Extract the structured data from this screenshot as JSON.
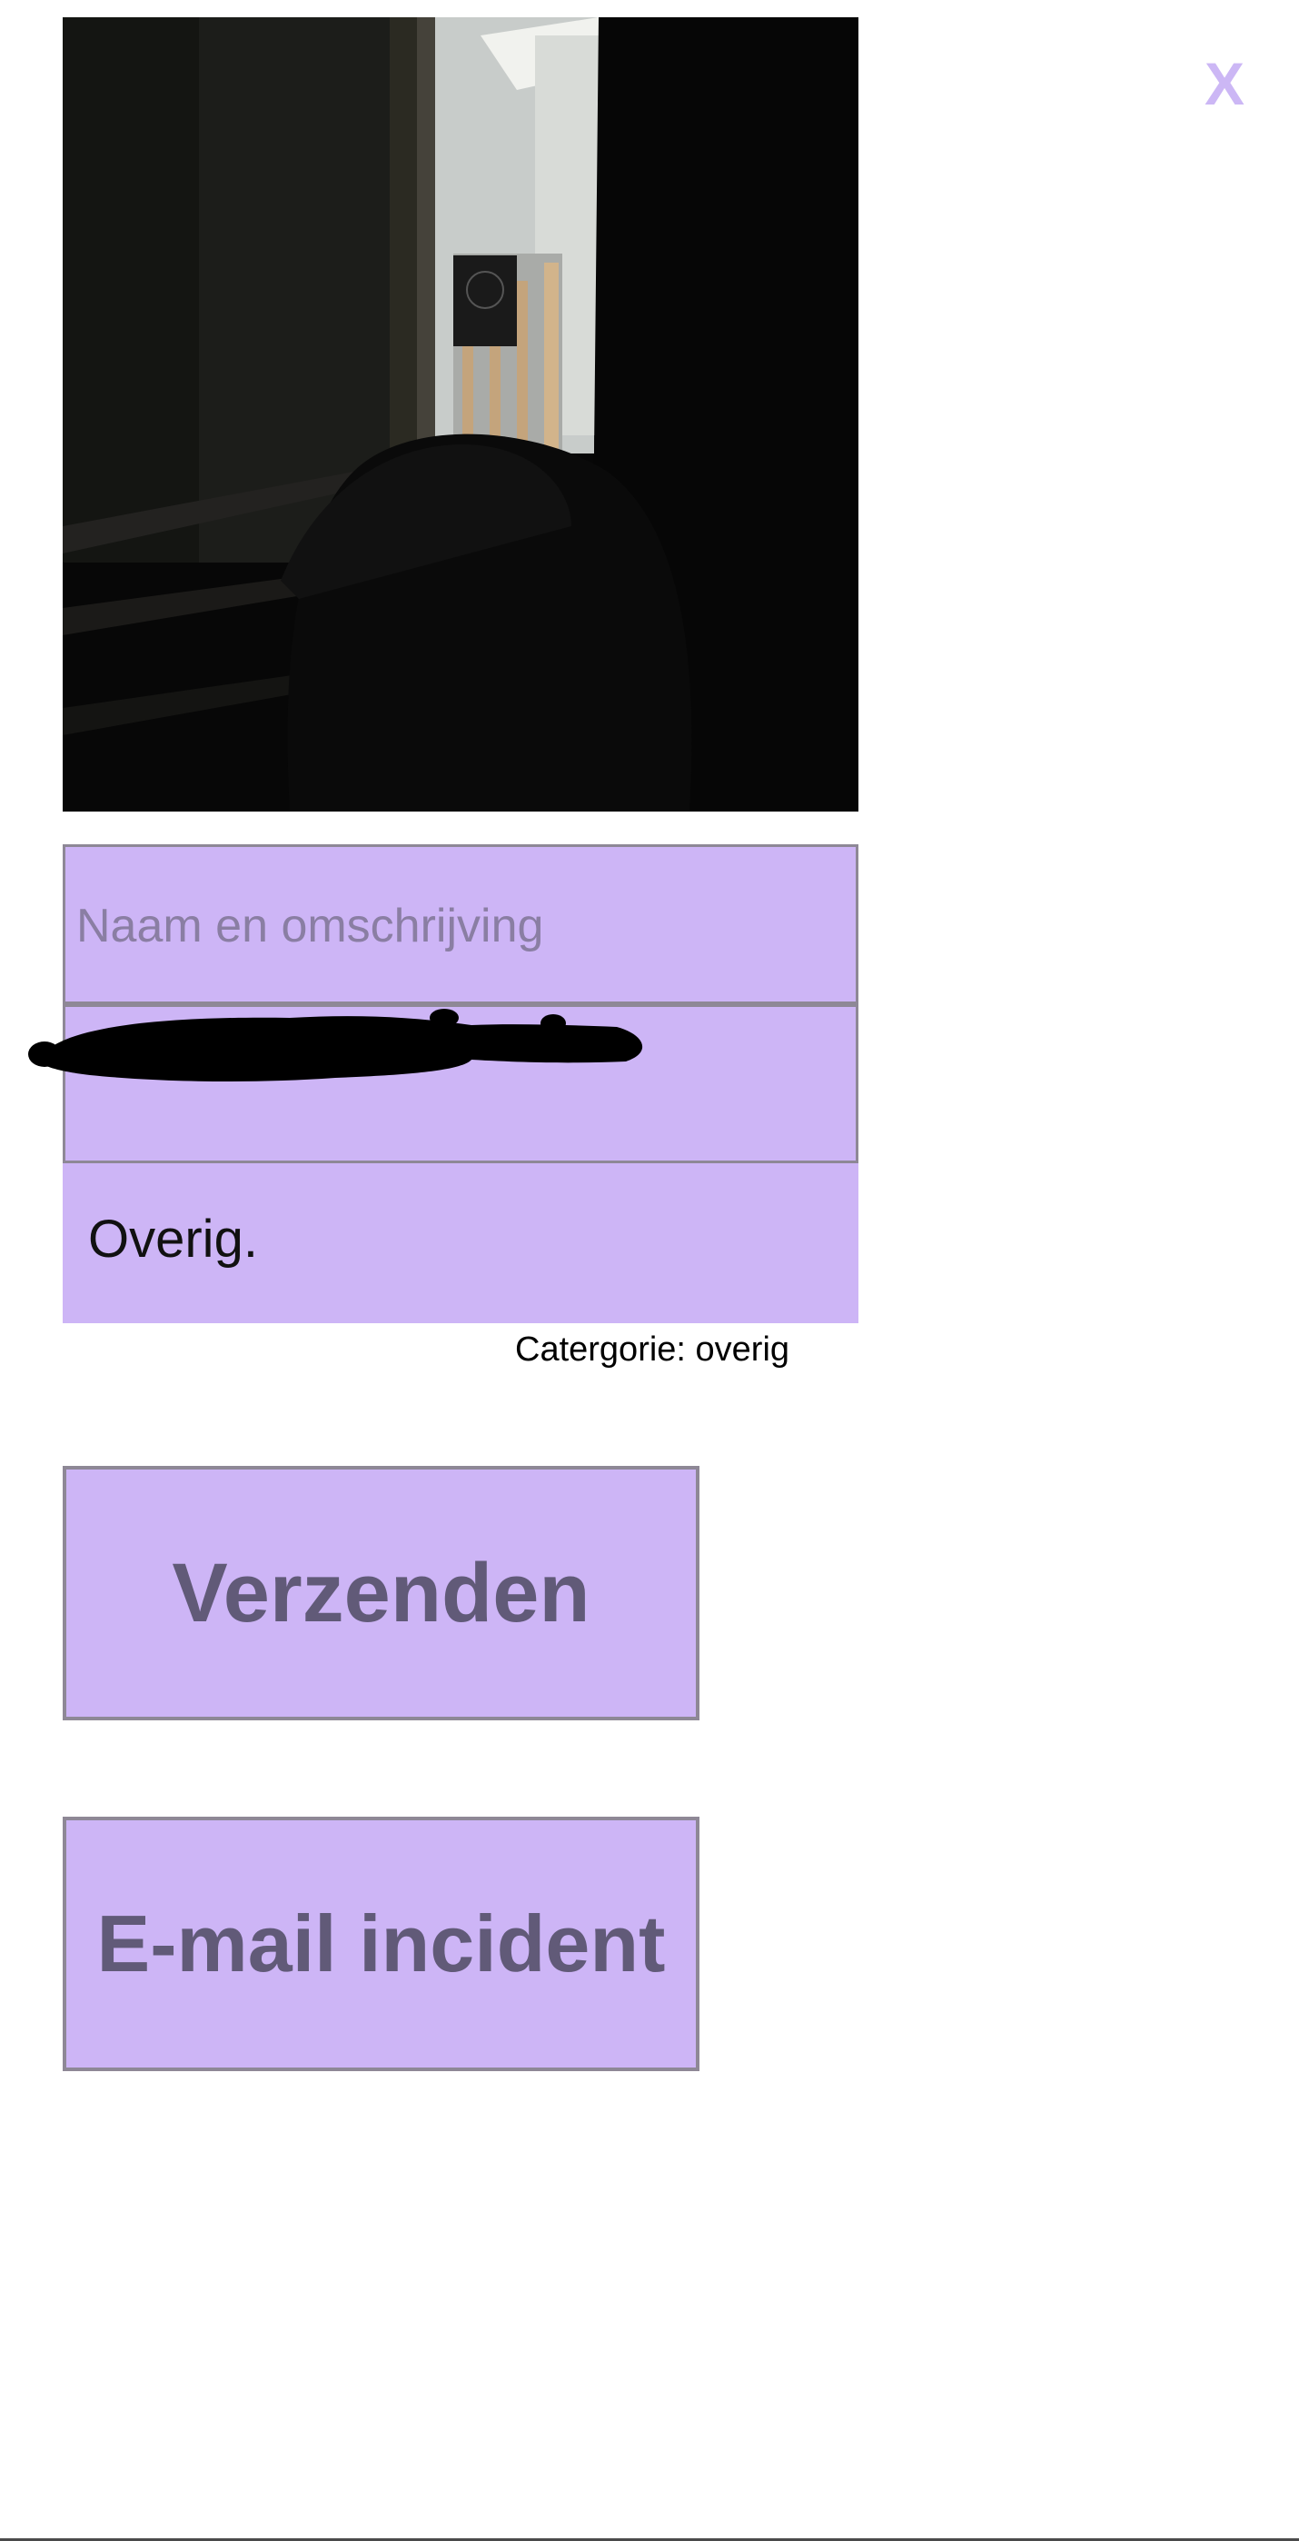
{
  "close": {
    "label": "X"
  },
  "form": {
    "name_placeholder": "Naam en omschrijving",
    "category_value": "Overig.",
    "category_label": "Catergorie: overig"
  },
  "buttons": {
    "send_label": "Verzenden",
    "email_label": "E-mail incident"
  },
  "colors": {
    "accent": "#cdb5f6",
    "button_text": "#615a78",
    "border": "#8e8896",
    "close": "#ccb7f5"
  }
}
